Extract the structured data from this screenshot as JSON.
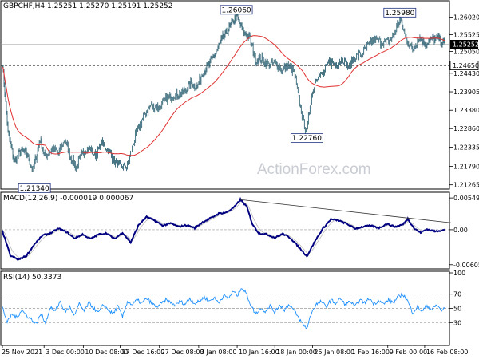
{
  "chart_data": [
    {
      "type": "candlestick",
      "title": "GBPCHF,H4",
      "ohlc_text": "1.25251 1.25270 1.25191 1.25252",
      "ylim": [
        1.2119,
        1.2644
      ],
      "y_ticks": [
        "1.26020",
        "1.25525",
        "1.25050",
        "1.24430",
        "1.23905",
        "1.23380",
        "1.22860",
        "1.22335",
        "1.21790",
        "1.21265"
      ],
      "current_price": "1.25252",
      "support_level": "1.24650",
      "support_value": 1.2465,
      "current_value": 1.25252,
      "watermark": "ActionForex.com",
      "price_anchors": [
        [
          0,
          1.2472
        ],
        [
          7,
          1.2275
        ],
        [
          15,
          1.2192
        ],
        [
          23,
          1.2224
        ],
        [
          30,
          1.2215
        ],
        [
          38,
          1.2168
        ],
        [
          47,
          1.2258
        ],
        [
          53,
          1.2205
        ],
        [
          62,
          1.223
        ],
        [
          70,
          1.2218
        ],
        [
          78,
          1.2254
        ],
        [
          85,
          1.2205
        ],
        [
          92,
          1.2176
        ],
        [
          100,
          1.2218
        ],
        [
          108,
          1.2232
        ],
        [
          116,
          1.221
        ],
        [
          124,
          1.2245
        ],
        [
          132,
          1.2225
        ],
        [
          140,
          1.2192
        ],
        [
          148,
          1.2176
        ],
        [
          156,
          1.218
        ],
        [
          165,
          1.2258
        ],
        [
          175,
          1.2315
        ],
        [
          185,
          1.2352
        ],
        [
          195,
          1.2346
        ],
        [
          205,
          1.2372
        ],
        [
          215,
          1.2382
        ],
        [
          225,
          1.2386
        ],
        [
          235,
          1.2414
        ],
        [
          243,
          1.2405
        ],
        [
          251,
          1.245
        ],
        [
          259,
          1.247
        ],
        [
          267,
          1.2505
        ],
        [
          275,
          1.2544
        ],
        [
          283,
          1.2572
        ],
        [
          292,
          1.2606
        ],
        [
          300,
          1.256
        ],
        [
          308,
          1.2548
        ],
        [
          316,
          1.248
        ],
        [
          324,
          1.2484
        ],
        [
          332,
          1.2466
        ],
        [
          340,
          1.2474
        ],
        [
          348,
          1.2452
        ],
        [
          356,
          1.2465
        ],
        [
          364,
          1.2446
        ],
        [
          370,
          1.237
        ],
        [
          376,
          1.23
        ],
        [
          380,
          1.2276
        ],
        [
          385,
          1.2372
        ],
        [
          392,
          1.2434
        ],
        [
          400,
          1.244
        ],
        [
          408,
          1.2476
        ],
        [
          416,
          1.2466
        ],
        [
          424,
          1.2486
        ],
        [
          432,
          1.246
        ],
        [
          440,
          1.249
        ],
        [
          448,
          1.2495
        ],
        [
          456,
          1.252
        ],
        [
          464,
          1.254
        ],
        [
          472,
          1.2532
        ],
        [
          480,
          1.253
        ],
        [
          488,
          1.2548
        ],
        [
          496,
          1.2598
        ],
        [
          504,
          1.254
        ],
        [
          512,
          1.251
        ],
        [
          520,
          1.2545
        ],
        [
          528,
          1.2525
        ],
        [
          536,
          1.254
        ],
        [
          544,
          1.254
        ],
        [
          552,
          1.2525
        ]
      ],
      "annotations": [
        {
          "label": "1.26060",
          "index": 292,
          "price": 1.2606,
          "side": "top"
        },
        {
          "label": "1.25980",
          "index": 496,
          "price": 1.2598,
          "side": "top"
        },
        {
          "label": "1.22760",
          "index": 380,
          "price": 1.2276,
          "side": "bottom"
        },
        {
          "label": "1.21340",
          "index": 40,
          "price": 1.2134,
          "side": "bottom"
        }
      ],
      "series": [
        {
          "name": "price",
          "color": "#336677"
        },
        {
          "color": "#e03030"
        }
      ]
    },
    {
      "type": "line",
      "title": "MACD(12,26,9) -0.000019 0.000067",
      "ylim": [
        -0.0065,
        0.0062
      ],
      "y_ticks": [
        "0.005492",
        "0.00",
        "-0.006057"
      ],
      "zero_label": "0.00",
      "macd_anchors": [
        [
          0,
          -0.0002
        ],
        [
          10,
          -0.0045
        ],
        [
          20,
          -0.0052
        ],
        [
          30,
          -0.0045
        ],
        [
          40,
          -0.0025
        ],
        [
          50,
          -0.001
        ],
        [
          60,
          -0.0006
        ],
        [
          70,
          0.0002
        ],
        [
          80,
          -0.0004
        ],
        [
          90,
          -0.0015
        ],
        [
          100,
          -0.0008
        ],
        [
          110,
          -0.0016
        ],
        [
          120,
          -0.0008
        ],
        [
          130,
          -0.0006
        ],
        [
          140,
          -0.0016
        ],
        [
          150,
          -0.0005
        ],
        [
          160,
          -0.0022
        ],
        [
          170,
          0.0008
        ],
        [
          180,
          0.0022
        ],
        [
          190,
          0.0016
        ],
        [
          200,
          0.0007
        ],
        [
          210,
          0.0011
        ],
        [
          220,
          0.0005
        ],
        [
          230,
          0.0008
        ],
        [
          240,
          0.0003
        ],
        [
          250,
          0.0013
        ],
        [
          260,
          0.002
        ],
        [
          270,
          0.0028
        ],
        [
          280,
          0.003
        ],
        [
          290,
          0.004
        ],
        [
          297,
          0.0052
        ],
        [
          305,
          0.004
        ],
        [
          312,
          0.001
        ],
        [
          320,
          -0.0006
        ],
        [
          330,
          -0.0008
        ],
        [
          340,
          -0.0014
        ],
        [
          350,
          -0.0007
        ],
        [
          360,
          -0.0015
        ],
        [
          370,
          -0.003
        ],
        [
          380,
          -0.0046
        ],
        [
          390,
          -0.002
        ],
        [
          400,
          0.0002
        ],
        [
          410,
          0.0018
        ],
        [
          420,
          0.0016
        ],
        [
          430,
          0.001
        ],
        [
          440,
          0.0002
        ],
        [
          450,
          0.0005
        ],
        [
          460,
          0.0007
        ],
        [
          470,
          0.0003
        ],
        [
          480,
          0.001
        ],
        [
          490,
          0.0005
        ],
        [
          500,
          0.0009
        ],
        [
          506,
          0.0019
        ],
        [
          514,
          0.0002
        ],
        [
          522,
          -0.0005
        ],
        [
          530,
          0.0001
        ],
        [
          540,
          -0.0003
        ],
        [
          552,
          0.0
        ]
      ],
      "series": [
        {
          "color": "#000080"
        },
        {
          "color": "#c0c0c0"
        }
      ],
      "trendline": [
        [
          297,
          0.0052
        ],
        [
          560,
          0.0012
        ]
      ]
    },
    {
      "type": "line",
      "title": "RSI(14) 50.3373",
      "ylim": [
        0,
        100
      ],
      "y_ticks": [
        "100",
        "70",
        "50",
        "30"
      ],
      "levels": [
        70,
        50,
        30
      ],
      "rsi_anchors": [
        [
          0,
          52
        ],
        [
          6,
          30
        ],
        [
          12,
          42
        ],
        [
          18,
          37
        ],
        [
          24,
          48
        ],
        [
          30,
          40
        ],
        [
          36,
          35
        ],
        [
          42,
          28
        ],
        [
          48,
          42
        ],
        [
          54,
          30
        ],
        [
          60,
          52
        ],
        [
          66,
          46
        ],
        [
          72,
          60
        ],
        [
          78,
          45
        ],
        [
          84,
          52
        ],
        [
          90,
          40
        ],
        [
          96,
          56
        ],
        [
          102,
          46
        ],
        [
          108,
          58
        ],
        [
          114,
          50
        ],
        [
          120,
          44
        ],
        [
          126,
          55
        ],
        [
          132,
          48
        ],
        [
          138,
          42
        ],
        [
          144,
          53
        ],
        [
          150,
          38
        ],
        [
          156,
          60
        ],
        [
          162,
          55
        ],
        [
          168,
          62
        ],
        [
          174,
          57
        ],
        [
          180,
          64
        ],
        [
          186,
          58
        ],
        [
          192,
          52
        ],
        [
          198,
          56
        ],
        [
          204,
          62
        ],
        [
          210,
          58
        ],
        [
          216,
          54
        ],
        [
          222,
          60
        ],
        [
          228,
          56
        ],
        [
          234,
          64
        ],
        [
          240,
          57
        ],
        [
          246,
          60
        ],
        [
          252,
          66
        ],
        [
          258,
          60
        ],
        [
          264,
          65
        ],
        [
          270,
          58
        ],
        [
          276,
          68
        ],
        [
          282,
          64
        ],
        [
          288,
          74
        ],
        [
          294,
          68
        ],
        [
          298,
          80
        ],
        [
          304,
          72
        ],
        [
          310,
          55
        ],
        [
          316,
          42
        ],
        [
          322,
          50
        ],
        [
          328,
          46
        ],
        [
          334,
          54
        ],
        [
          340,
          44
        ],
        [
          346,
          55
        ],
        [
          352,
          48
        ],
        [
          358,
          56
        ],
        [
          364,
          47
        ],
        [
          370,
          36
        ],
        [
          376,
          26
        ],
        [
          380,
          22
        ],
        [
          386,
          45
        ],
        [
          392,
          56
        ],
        [
          398,
          60
        ],
        [
          404,
          52
        ],
        [
          410,
          62
        ],
        [
          416,
          57
        ],
        [
          422,
          64
        ],
        [
          428,
          55
        ],
        [
          434,
          60
        ],
        [
          440,
          52
        ],
        [
          446,
          62
        ],
        [
          452,
          58
        ],
        [
          458,
          64
        ],
        [
          464,
          56
        ],
        [
          470,
          62
        ],
        [
          476,
          56
        ],
        [
          482,
          62
        ],
        [
          488,
          58
        ],
        [
          494,
          66
        ],
        [
          500,
          70
        ],
        [
          506,
          60
        ],
        [
          512,
          44
        ],
        [
          518,
          52
        ],
        [
          524,
          46
        ],
        [
          530,
          54
        ],
        [
          536,
          48
        ],
        [
          542,
          55
        ],
        [
          548,
          47
        ],
        [
          552,
          50
        ]
      ],
      "series": [
        {
          "color": "#1e90ff"
        }
      ]
    }
  ],
  "x_ticks": [
    {
      "label": "25 Nov 2021",
      "index": 0
    },
    {
      "label": "3 Dec 00:00",
      "index": 52
    },
    {
      "label": "10 Dec 08:00",
      "index": 101
    },
    {
      "label": "17 Dec 16:00",
      "index": 147
    },
    {
      "label": "27 Dec 08:00",
      "index": 196
    },
    {
      "label": "3 Jan 08:00",
      "index": 245
    },
    {
      "label": "10 Jan 16:00",
      "index": 293
    },
    {
      "label": "18 Jan 00:00",
      "index": 340
    },
    {
      "label": "25 Jan 08:00",
      "index": 387
    },
    {
      "label": "1 Feb 16:00",
      "index": 434
    },
    {
      "label": "9 Feb 00:00",
      "index": 481
    },
    {
      "label": "16 Feb 08:00",
      "index": 527
    }
  ],
  "colors": {
    "grid": "#b8b8b8",
    "frame": "#000000",
    "label_box_border": "#203080",
    "current_price_bg": "#000000"
  }
}
